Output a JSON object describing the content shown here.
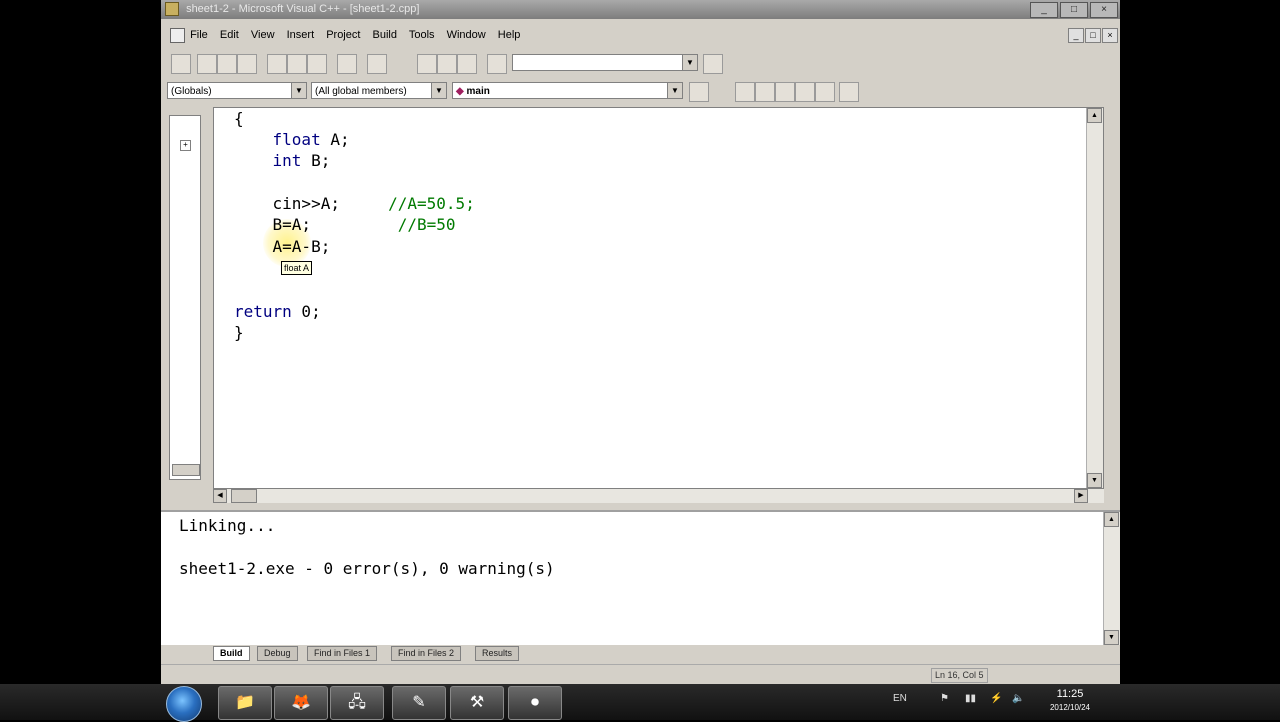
{
  "window": {
    "title": "sheet1-2 - Microsoft Visual C++ - [sheet1-2.cpp]",
    "controls": [
      "_",
      "□",
      "×"
    ]
  },
  "menu": {
    "items": [
      "File",
      "Edit",
      "View",
      "Insert",
      "Project",
      "Build",
      "Tools",
      "Window",
      "Help"
    ]
  },
  "toolbar": {
    "find_combo_value": ""
  },
  "wizardbar": {
    "class_combo": "(Globals)",
    "filter_combo": "(All global members)",
    "member_combo": "main"
  },
  "editor": {
    "lines": [
      "{",
      "    float A;",
      "    int B;",
      "",
      "    cin>>A;     //A=50.5;",
      "    B=A;         //B=50",
      "    A=A-B;",
      "",
      "",
      "return 0;",
      "}"
    ],
    "tooltip": "float A"
  },
  "output": {
    "lines": [
      "Linking...",
      "",
      "sheet1-2.exe - 0 error(s), 0 warning(s)"
    ],
    "tabs": [
      "Build",
      "Debug",
      "Find in Files 1",
      "Find in Files 2",
      "Results"
    ],
    "active_tab": "Build"
  },
  "statusbar": {
    "position": "Ln 16, Col 5"
  },
  "taskbar": {
    "language": "EN",
    "time": "11:25",
    "date": "2012/10/24"
  }
}
